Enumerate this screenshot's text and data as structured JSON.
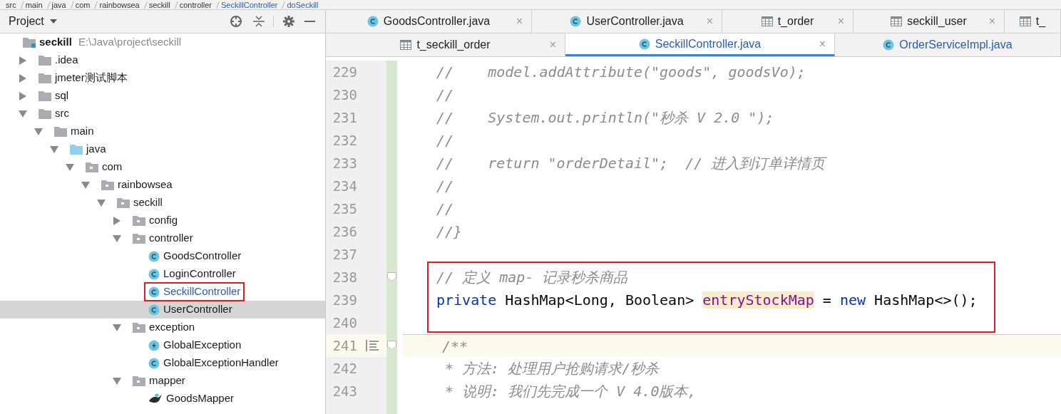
{
  "breadcrumb": [
    "src",
    "main",
    "java",
    "com",
    "rainbowsea",
    "seckill",
    "controller",
    "SeckillController",
    "doSeckill"
  ],
  "project_panel": {
    "title": "Project"
  },
  "tree": [
    {
      "label": "seckill",
      "kind": "module",
      "hint": "E:\\Java\\project\\seckill",
      "selected": false,
      "children": [
        {
          "label": ".idea",
          "kind": "folder",
          "expanded": false,
          "selected": false
        },
        {
          "label": "jmeter测试脚本",
          "kind": "folder",
          "expanded": false,
          "selected": false
        },
        {
          "label": "sql",
          "kind": "folder",
          "expanded": false,
          "selected": false
        },
        {
          "label": "src",
          "kind": "folder",
          "expanded": true,
          "selected": false,
          "children": [
            {
              "label": "main",
              "kind": "folder",
              "expanded": true,
              "selected": false,
              "children": [
                {
                  "label": "java",
                  "kind": "source-folder",
                  "expanded": true,
                  "selected": false,
                  "children": [
                    {
                      "label": "com",
                      "kind": "package",
                      "expanded": true,
                      "selected": false,
                      "children": [
                        {
                          "label": "rainbowsea",
                          "kind": "package",
                          "expanded": true,
                          "selected": false,
                          "children": [
                            {
                              "label": "seckill",
                              "kind": "package",
                              "expanded": true,
                              "selected": false,
                              "children": [
                                {
                                  "label": "config",
                                  "kind": "package",
                                  "expanded": false,
                                  "selected": false
                                },
                                {
                                  "label": "controller",
                                  "kind": "package",
                                  "expanded": true,
                                  "selected": false,
                                  "children": [
                                    {
                                      "label": "GoodsController",
                                      "kind": "class",
                                      "selected": false,
                                      "modified": false,
                                      "boxed": false
                                    },
                                    {
                                      "label": "LoginController",
                                      "kind": "class",
                                      "selected": false,
                                      "modified": false,
                                      "boxed": false
                                    },
                                    {
                                      "label": "SeckillController",
                                      "kind": "class",
                                      "selected": false,
                                      "modified": true,
                                      "boxed": true
                                    },
                                    {
                                      "label": "UserController",
                                      "kind": "class",
                                      "selected": true,
                                      "modified": false,
                                      "boxed": false
                                    }
                                  ]
                                },
                                {
                                  "label": "exception",
                                  "kind": "package",
                                  "expanded": true,
                                  "selected": false,
                                  "children": [
                                    {
                                      "label": "GlobalException",
                                      "kind": "exception",
                                      "selected": false
                                    },
                                    {
                                      "label": "GlobalExceptionHandler",
                                      "kind": "class",
                                      "selected": false,
                                      "modified": false,
                                      "boxed": false
                                    }
                                  ]
                                },
                                {
                                  "label": "mapper",
                                  "kind": "package",
                                  "expanded": true,
                                  "selected": false,
                                  "children": [
                                    {
                                      "label": "GoodsMapper",
                                      "kind": "mapper",
                                      "selected": false
                                    }
                                  ]
                                }
                              ]
                            }
                          ]
                        }
                      ]
                    }
                  ]
                }
              ]
            }
          ]
        }
      ]
    }
  ],
  "tab_rows": [
    [
      {
        "label": "GoodsController.java",
        "kind": "class",
        "selected": false,
        "close": "×"
      },
      {
        "label": "UserController.java",
        "kind": "class",
        "selected": false,
        "close": "×"
      },
      {
        "label": "t_order",
        "kind": "table",
        "selected": false,
        "close": "×"
      },
      {
        "label": "seckill_user",
        "kind": "table",
        "selected": false,
        "close": "×"
      },
      {
        "label": "t_",
        "kind": "table",
        "selected": false
      }
    ],
    [
      {
        "label": "t_seckill_order",
        "kind": "table",
        "selected": false,
        "close": "×"
      },
      {
        "label": "SeckillController.java",
        "kind": "class",
        "selected": true,
        "close": "×"
      },
      {
        "label": "OrderServiceImpl.java",
        "kind": "class",
        "selected": false
      }
    ]
  ],
  "code_lines": [
    {
      "number": "229",
      "tokens": [
        {
          "text": "//    model.addAttribute(\"goods\", goodsVo);",
          "kind": "comment"
        }
      ]
    },
    {
      "number": "230",
      "tokens": [
        {
          "text": "//",
          "kind": "comment"
        }
      ]
    },
    {
      "number": "231",
      "tokens": [
        {
          "text": "//    System.out.println(\"秒杀 V 2.0 \");",
          "kind": "comment"
        }
      ]
    },
    {
      "number": "232",
      "tokens": [
        {
          "text": "//",
          "kind": "comment"
        }
      ]
    },
    {
      "number": "233",
      "tokens": [
        {
          "text": "//    return \"orderDetail\";  // 进入到订单详情页",
          "kind": "comment"
        }
      ]
    },
    {
      "number": "234",
      "tokens": [
        {
          "text": "//",
          "kind": "comment"
        }
      ]
    },
    {
      "number": "235",
      "tokens": [
        {
          "text": "//",
          "kind": "comment"
        }
      ]
    },
    {
      "number": "236",
      "tokens": [
        {
          "text": "//}",
          "kind": "comment"
        }
      ]
    },
    {
      "number": "237"
    },
    {
      "number": "238",
      "fold": true,
      "boxed": true,
      "tokens": [
        {
          "text": "// 定义 map- 记录秒杀商品",
          "kind": "comment"
        }
      ]
    },
    {
      "number": "239",
      "boxed": true,
      "tokens": [
        {
          "text": "private",
          "kind": "keyword"
        },
        {
          "text": " HashMap<Long, Boolean> ",
          "kind": "plain"
        },
        {
          "text": "entryStockMap",
          "kind": "field-highlighted"
        },
        {
          "text": " = ",
          "kind": "plain"
        },
        {
          "text": "new",
          "kind": "keyword"
        },
        {
          "text": " HashMap<>();",
          "kind": "plain"
        }
      ]
    },
    {
      "number": "240",
      "boxed": true
    },
    {
      "number": "241",
      "fold": true,
      "current": true,
      "separator": true,
      "doc": true,
      "tokens": [
        {
          "text": "/**",
          "kind": "comment"
        }
      ]
    },
    {
      "number": "242",
      "tokens": [
        {
          "text": " * 方法: 处理用户抢购请求/秒杀",
          "kind": "comment"
        }
      ]
    },
    {
      "number": "243",
      "tokens": [
        {
          "text": " * 说明: 我们先完成一个 V 4.0版本,",
          "kind": "comment"
        }
      ]
    }
  ]
}
